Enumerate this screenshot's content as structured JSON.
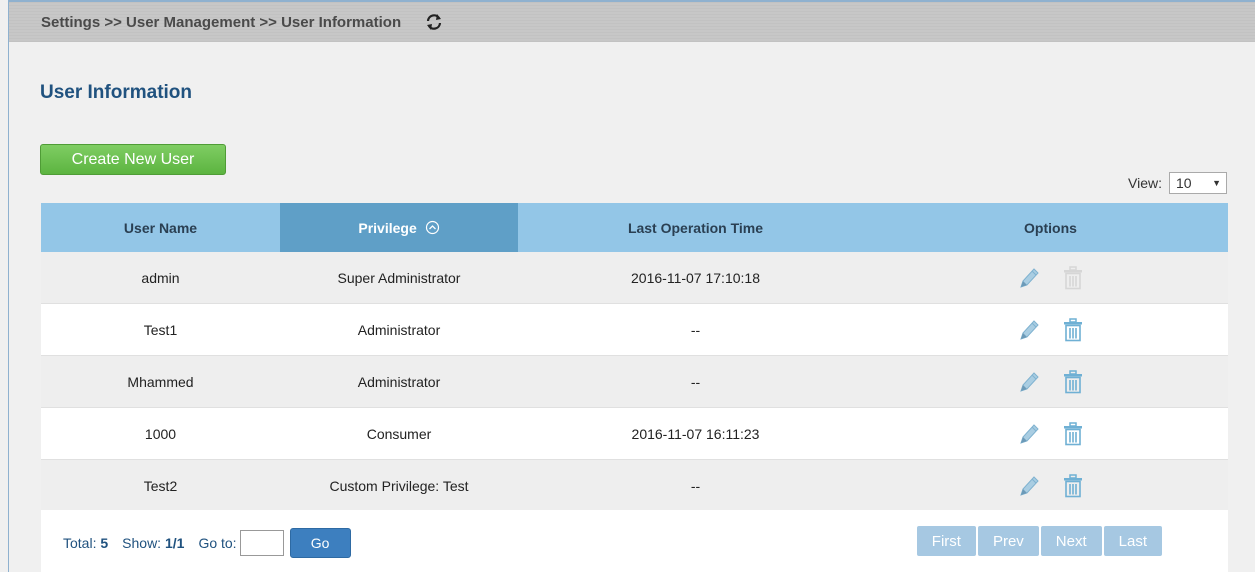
{
  "breadcrumb": "Settings >> User Management >> User Information",
  "page_title": "User Information",
  "create_button": "Create New User",
  "view": {
    "label": "View:",
    "value": "10"
  },
  "table": {
    "columns": [
      "User Name",
      "Privilege",
      "Last Operation Time",
      "Options"
    ],
    "sorted_column": "Privilege",
    "rows": [
      {
        "user": "admin",
        "privilege": "Super Administrator",
        "time": "2016-11-07 17:10:18",
        "delete_enabled": false
      },
      {
        "user": "Test1",
        "privilege": "Administrator",
        "time": "--",
        "delete_enabled": true
      },
      {
        "user": "Mhammed",
        "privilege": "Administrator",
        "time": "--",
        "delete_enabled": true
      },
      {
        "user": "1000",
        "privilege": "Consumer",
        "time": "2016-11-07 16:11:23",
        "delete_enabled": true
      },
      {
        "user": "Test2",
        "privilege": "Custom Privilege: Test",
        "time": "--",
        "delete_enabled": true
      }
    ]
  },
  "footer": {
    "total_label": "Total:",
    "total_value": "5",
    "show_label": "Show:",
    "show_value": "1/1",
    "goto_label": "Go to:",
    "go_button": "Go",
    "pager": [
      "First",
      "Prev",
      "Next",
      "Last"
    ]
  },
  "colors": {
    "header": "#93c6e7",
    "header_sorted": "#5f9fc7",
    "create_button": "#6cbf4f",
    "go_button": "#3d7fbf",
    "title": "#20527f"
  },
  "icons": {
    "refresh": "refresh-icon",
    "sort": "sort-ascending-icon",
    "edit": "pencil-icon",
    "delete": "trash-icon"
  }
}
